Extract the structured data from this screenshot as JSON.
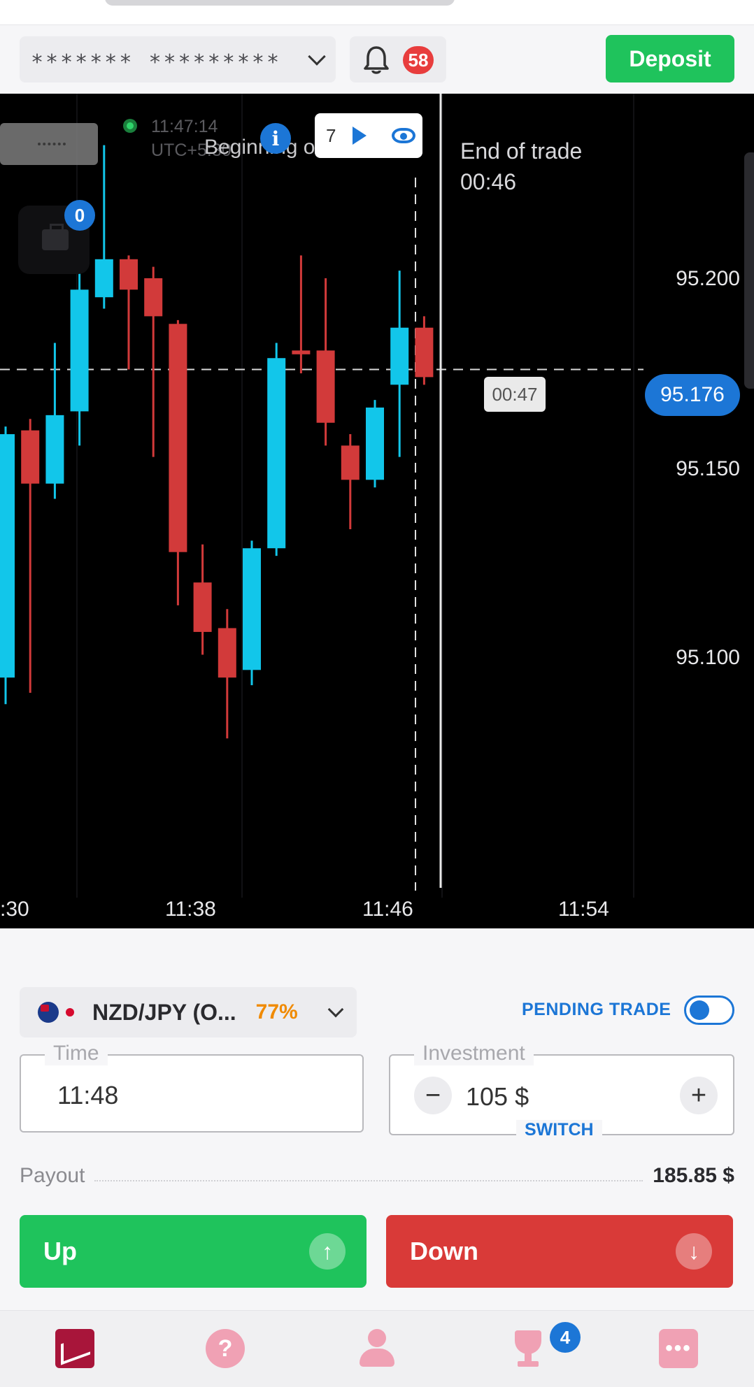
{
  "header": {
    "account_masked": "******* *********",
    "notifications_count": "58",
    "deposit_label": "Deposit"
  },
  "chart": {
    "clock": "11:47:14",
    "timezone": "UTC+5:30",
    "portfolio_count": "0",
    "info_icon": "i",
    "beginning_label": "Beginning of trade",
    "control_count": "7",
    "end_label": "End of trade",
    "end_countdown": "00:46",
    "current_price": "95.176",
    "current_countdown": "00:47",
    "price_ticks": [
      "95.200",
      "95.150",
      "95.100"
    ],
    "time_ticks": [
      ":30",
      "11:38",
      "11:46",
      "11:54"
    ]
  },
  "chart_data": {
    "type": "candlestick",
    "y_ticks": [
      95.2,
      95.15,
      95.1
    ],
    "x_ticks": [
      ":30",
      "11:38",
      "11:46",
      "11:54"
    ],
    "current_price": 95.176,
    "colors": {
      "up": "#12c6ea",
      "down": "#d23a3a"
    },
    "candles": [
      {
        "dir": "up",
        "open": 95.095,
        "close": 95.159,
        "high": 95.161,
        "low": 95.088
      },
      {
        "dir": "down",
        "open": 95.16,
        "close": 95.146,
        "high": 95.163,
        "low": 95.091
      },
      {
        "dir": "up",
        "open": 95.146,
        "close": 95.164,
        "high": 95.183,
        "low": 95.142
      },
      {
        "dir": "up",
        "open": 95.165,
        "close": 95.197,
        "high": 95.202,
        "low": 95.156
      },
      {
        "dir": "up",
        "open": 95.195,
        "close": 95.205,
        "high": 95.235,
        "low": 95.192
      },
      {
        "dir": "down",
        "open": 95.205,
        "close": 95.197,
        "high": 95.206,
        "low": 95.176
      },
      {
        "dir": "down",
        "open": 95.2,
        "close": 95.19,
        "high": 95.203,
        "low": 95.153
      },
      {
        "dir": "down",
        "open": 95.188,
        "close": 95.128,
        "high": 95.189,
        "low": 95.114
      },
      {
        "dir": "down",
        "open": 95.12,
        "close": 95.107,
        "high": 95.13,
        "low": 95.101
      },
      {
        "dir": "down",
        "open": 95.108,
        "close": 95.095,
        "high": 95.113,
        "low": 95.079
      },
      {
        "dir": "up",
        "open": 95.097,
        "close": 95.129,
        "high": 95.131,
        "low": 95.093
      },
      {
        "dir": "up",
        "open": 95.129,
        "close": 95.179,
        "high": 95.183,
        "low": 95.127
      },
      {
        "dir": "down",
        "open": 95.181,
        "close": 95.18,
        "high": 95.206,
        "low": 95.175
      },
      {
        "dir": "down",
        "open": 95.181,
        "close": 95.162,
        "high": 95.2,
        "low": 95.156
      },
      {
        "dir": "down",
        "open": 95.156,
        "close": 95.147,
        "high": 95.159,
        "low": 95.134
      },
      {
        "dir": "up",
        "open": 95.147,
        "close": 95.166,
        "high": 95.168,
        "low": 95.145
      },
      {
        "dir": "up",
        "open": 95.172,
        "close": 95.187,
        "high": 95.202,
        "low": 95.153
      },
      {
        "dir": "down",
        "open": 95.187,
        "close": 95.174,
        "high": 95.19,
        "low": 95.172
      }
    ]
  },
  "trade": {
    "asset_name": "NZD/JPY (O...",
    "asset_payout": "77%",
    "pending_label": "PENDING TRADE",
    "time_label": "Time",
    "time_value": "11:48",
    "investment_label": "Investment",
    "investment_value": "105 $",
    "minus": "−",
    "plus": "+",
    "switch_label": "SWITCH",
    "payout_label": "Payout",
    "payout_value": "185.85 $",
    "up_label": "Up",
    "down_label": "Down",
    "up_arrow": "↑",
    "down_arrow": "↓"
  },
  "nav": {
    "help_glyph": "?",
    "more_glyph": "•••",
    "trophy_badge": "4"
  }
}
